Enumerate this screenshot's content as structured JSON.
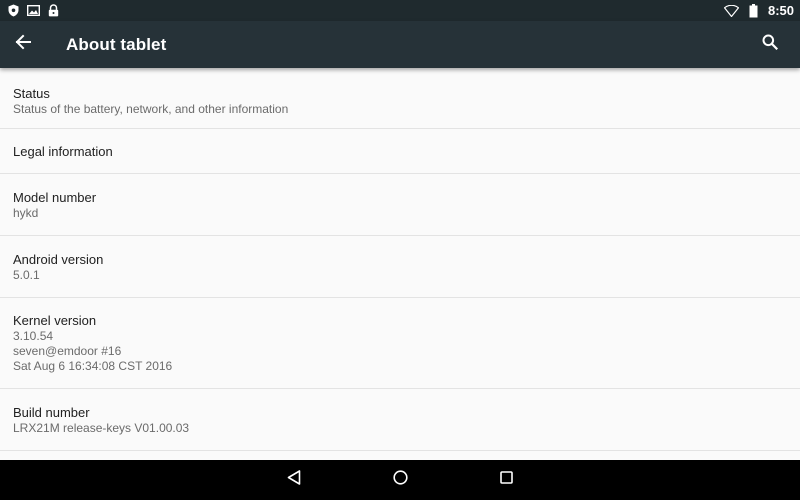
{
  "status_bar": {
    "time": "8:50",
    "left_icons": [
      "shield-icon",
      "image-icon",
      "lock-icon"
    ],
    "right_icons": [
      "wifi-icon",
      "battery-icon"
    ]
  },
  "toolbar": {
    "title": "About tablet",
    "back_icon": "arrow-back-icon",
    "search_icon": "search-icon"
  },
  "items": [
    {
      "title": "Status",
      "summary": [
        "Status of the battery, network, and other information"
      ]
    },
    {
      "title": "Legal information",
      "summary": []
    },
    {
      "title": "Model number",
      "summary": [
        "hykd"
      ]
    },
    {
      "title": "Android version",
      "summary": [
        "5.0.1"
      ]
    },
    {
      "title": "Kernel version",
      "summary": [
        "3.10.54",
        "seven@emdoor #16",
        "Sat Aug 6 16:34:08 CST 2016"
      ]
    },
    {
      "title": "Build number",
      "summary": [
        "LRX21M release-keys V01.00.03"
      ]
    }
  ],
  "nav_bar": {
    "buttons": [
      "back-triangle-icon",
      "home-circle-icon",
      "recents-square-icon"
    ]
  }
}
